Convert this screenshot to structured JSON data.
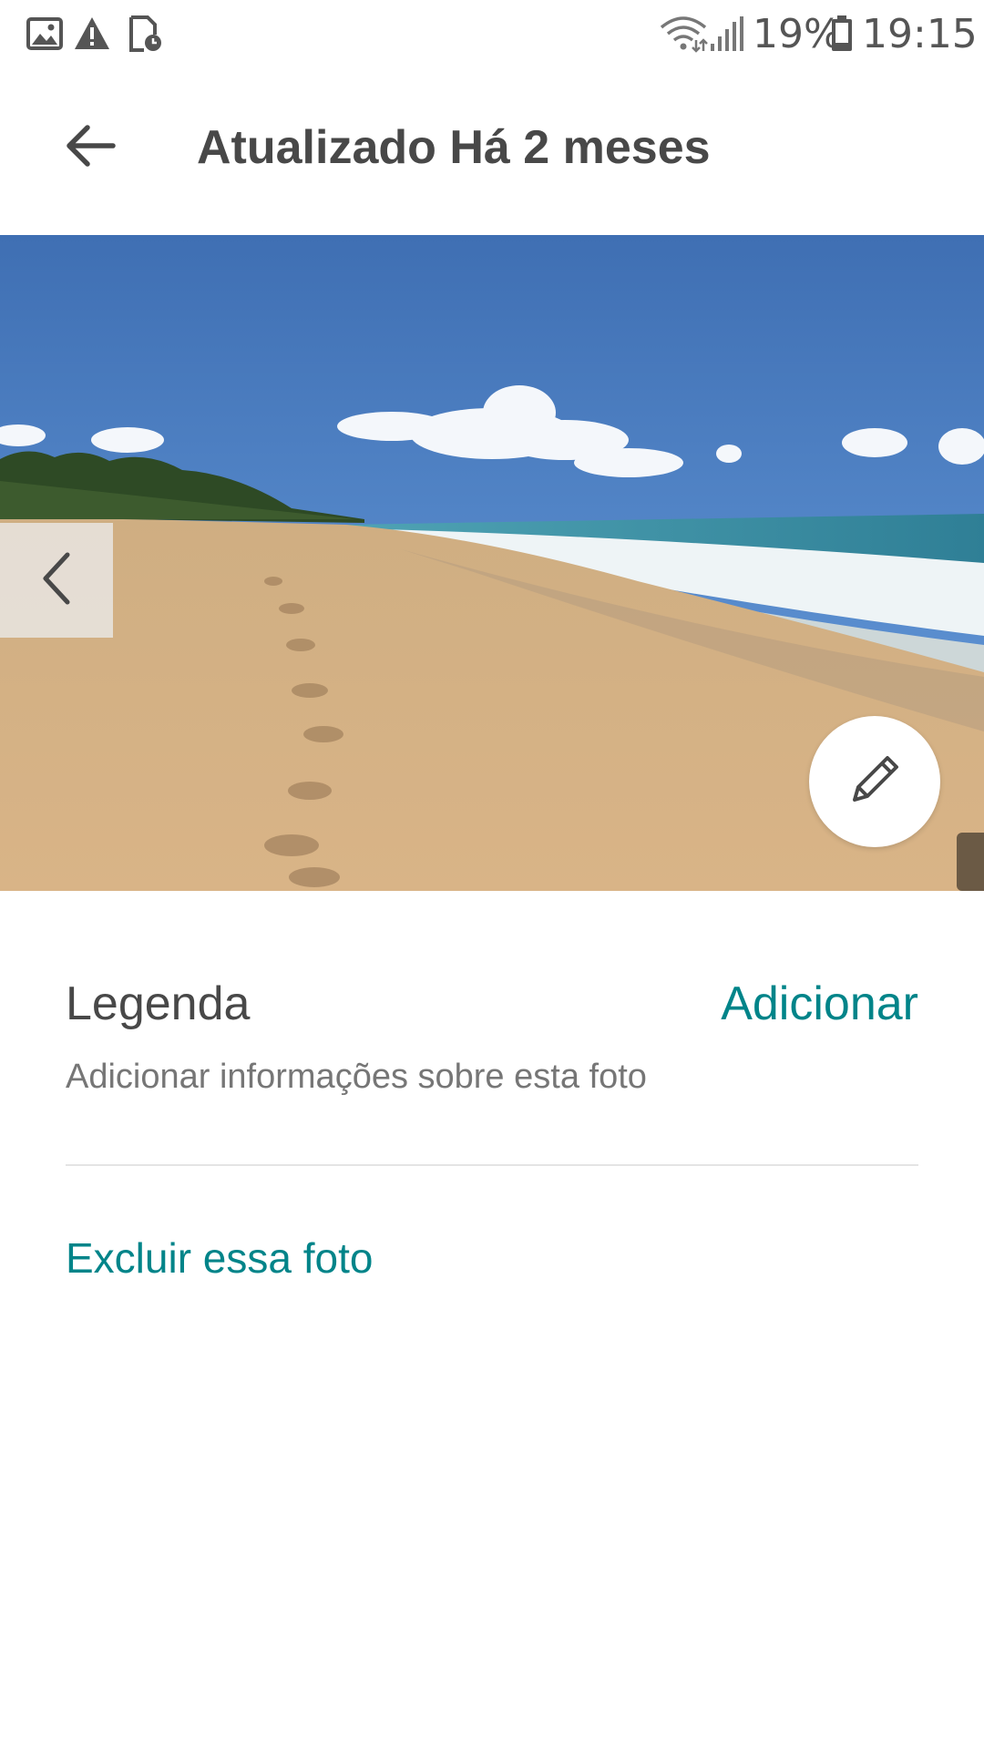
{
  "status_bar": {
    "icons_left": [
      "image-icon",
      "warning-icon",
      "document-clock-icon"
    ],
    "icons_right": [
      "wifi-icon",
      "signal-icon",
      "battery-icon"
    ],
    "battery": "19%",
    "time": "19:15"
  },
  "header": {
    "back_icon": "arrow-left-icon",
    "title": "Atualizado Há 2 meses"
  },
  "photo": {
    "prev_icon": "chevron-left-icon",
    "edit_icon": "pencil-icon"
  },
  "caption": {
    "label": "Legenda",
    "add_label": "Adicionar",
    "hint": "Adicionar informações sobre esta foto"
  },
  "actions": {
    "delete_label": "Excluir essa foto"
  },
  "colors": {
    "accent": "#008489",
    "text": "#484848",
    "secondary_text": "#767676"
  }
}
